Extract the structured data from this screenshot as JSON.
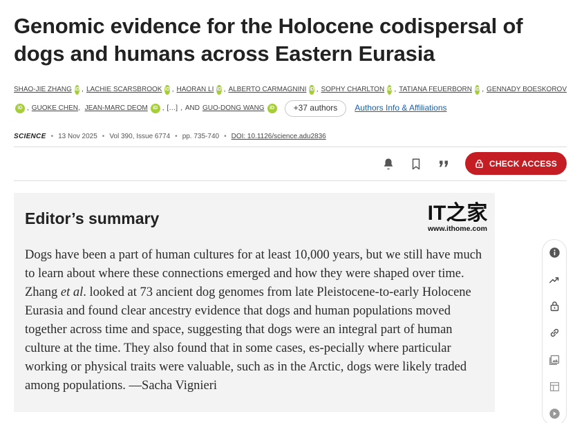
{
  "article": {
    "title": "Genomic evidence for the Holocene codispersal of dogs and humans across Eastern Eurasia"
  },
  "authors": {
    "row1": [
      "SHAO-JIE ZHANG",
      "LACHIE SCARSBROOK",
      "HAORAN LI",
      "ALBERTO CARMAGNINI",
      "SOPHY CHARLTON",
      "TATIANA FEUERBORN",
      "GENNADY BOESKOROV"
    ],
    "row2_a": "GUOKE CHEN",
    "row2_b": "JEAN-MARC DEOM",
    "ellipsis": "[…]",
    "and_label": "AND",
    "last": "GUO-DONG WANG",
    "orcid_label": "iD",
    "more_button": "+37 authors",
    "affiliations_link": "Authors Info & Affiliations"
  },
  "meta": {
    "journal": "SCIENCE",
    "date": "13 Nov 2025",
    "volume": "Vol 390, Issue 6774",
    "pages": "pp. 735-740",
    "doi": "DOI: 10.1126/science.adu2836"
  },
  "toolbar": {
    "icons": [
      "bell-icon",
      "bookmark-icon",
      "quote-icon"
    ],
    "check_access_label": "CHECK ACCESS"
  },
  "summary": {
    "heading": "Editor’s summary",
    "text_before_etal": "Dogs have been a part of human cultures for at least 10,000 years, but we still have much to learn about where these connections emerged and how they were shaped over time. Zhang ",
    "etal": "et al",
    "text_after_etal": ". looked at 73 ancient dog genomes from late Pleistocene-to-early Holocene Eurasia and found clear ancestry evidence that dogs and human populations moved together across time and space, suggesting that dogs were an integral part of human culture at the time. They also found that in some cases, es-pecially where particular working or physical traits were valuable, such as in the Arctic, dogs were likely traded among populations. —Sacha Vignieri"
  },
  "watermark": {
    "logo_text": "IT之家",
    "url": "www.ithome.com"
  },
  "side_rail": {
    "icons": [
      "info-icon",
      "trending-icon",
      "lock-icon",
      "link-icon",
      "image-icon",
      "table-icon",
      "play-icon"
    ]
  },
  "colors": {
    "accent": "#c41e24",
    "orcid": "#a6ce39",
    "link": "#1a5fa8",
    "summary_bg": "#f3f3f3"
  }
}
